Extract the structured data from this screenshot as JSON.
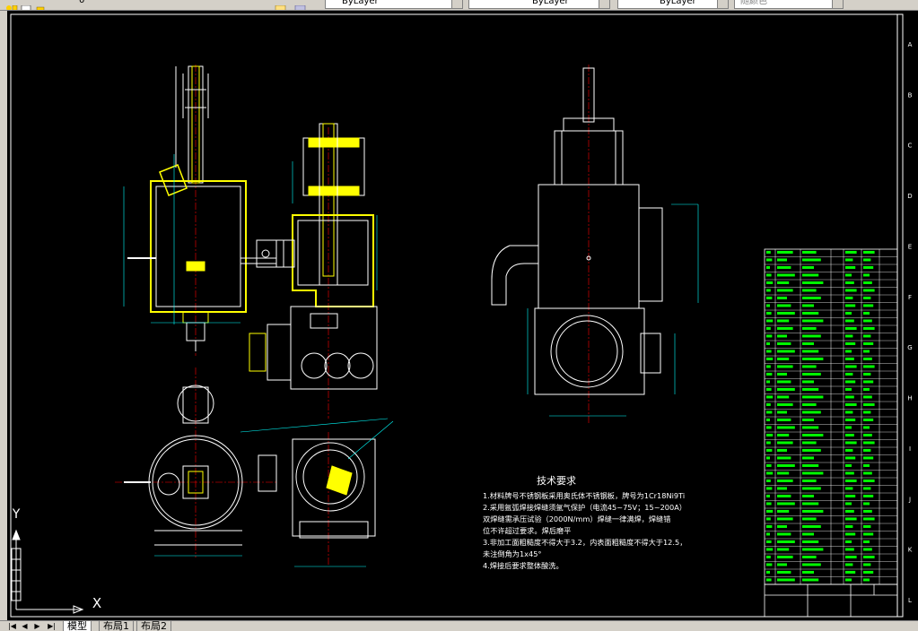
{
  "toolbar": {
    "layer_name": "0",
    "color_combo": "ByLayer",
    "linetype_combo": "ByLayer",
    "lineweight_combo": "ByLayer",
    "plotstyle_combo": "随颜色"
  },
  "tech_requirements": {
    "title": "技术要求",
    "lines": [
      "1.材料牌号不锈钢板采用奥氏体不锈钢板，牌号为1Cr18Ni9Ti",
      "2.采用氩弧焊接焊缝须氩气保护（电流45~75V；15~200A）",
      "  双焊缝需承压试验（2000N/mm）焊缝一律满焊，焊缝错",
      "  位不许超过要求。焊后磨平",
      "3.非加工面粗糙度不得大于3.2，内表面粗糙度不得大于12.5，",
      "  未注倒角为1x45°",
      "4.焊接后要求整体酸洗。"
    ]
  },
  "ucs": {
    "x_label": "X",
    "y_label": "Y"
  },
  "border_letters_right": [
    "A",
    "B",
    "C",
    "D",
    "E",
    "F",
    "G",
    "H",
    "I",
    "J",
    "K",
    "L"
  ],
  "tabs": {
    "nav": [
      "|◀",
      "◀",
      "▶",
      "▶|"
    ],
    "model": "模型",
    "layout1": "布局1",
    "layout2": "布局2"
  },
  "colors": {
    "canvas": "#000000",
    "geometry": "#ffffff",
    "highlight": "#ffff00",
    "dimension": "#00ffff",
    "centerline": "#ff0000",
    "table": "#00ff00"
  }
}
